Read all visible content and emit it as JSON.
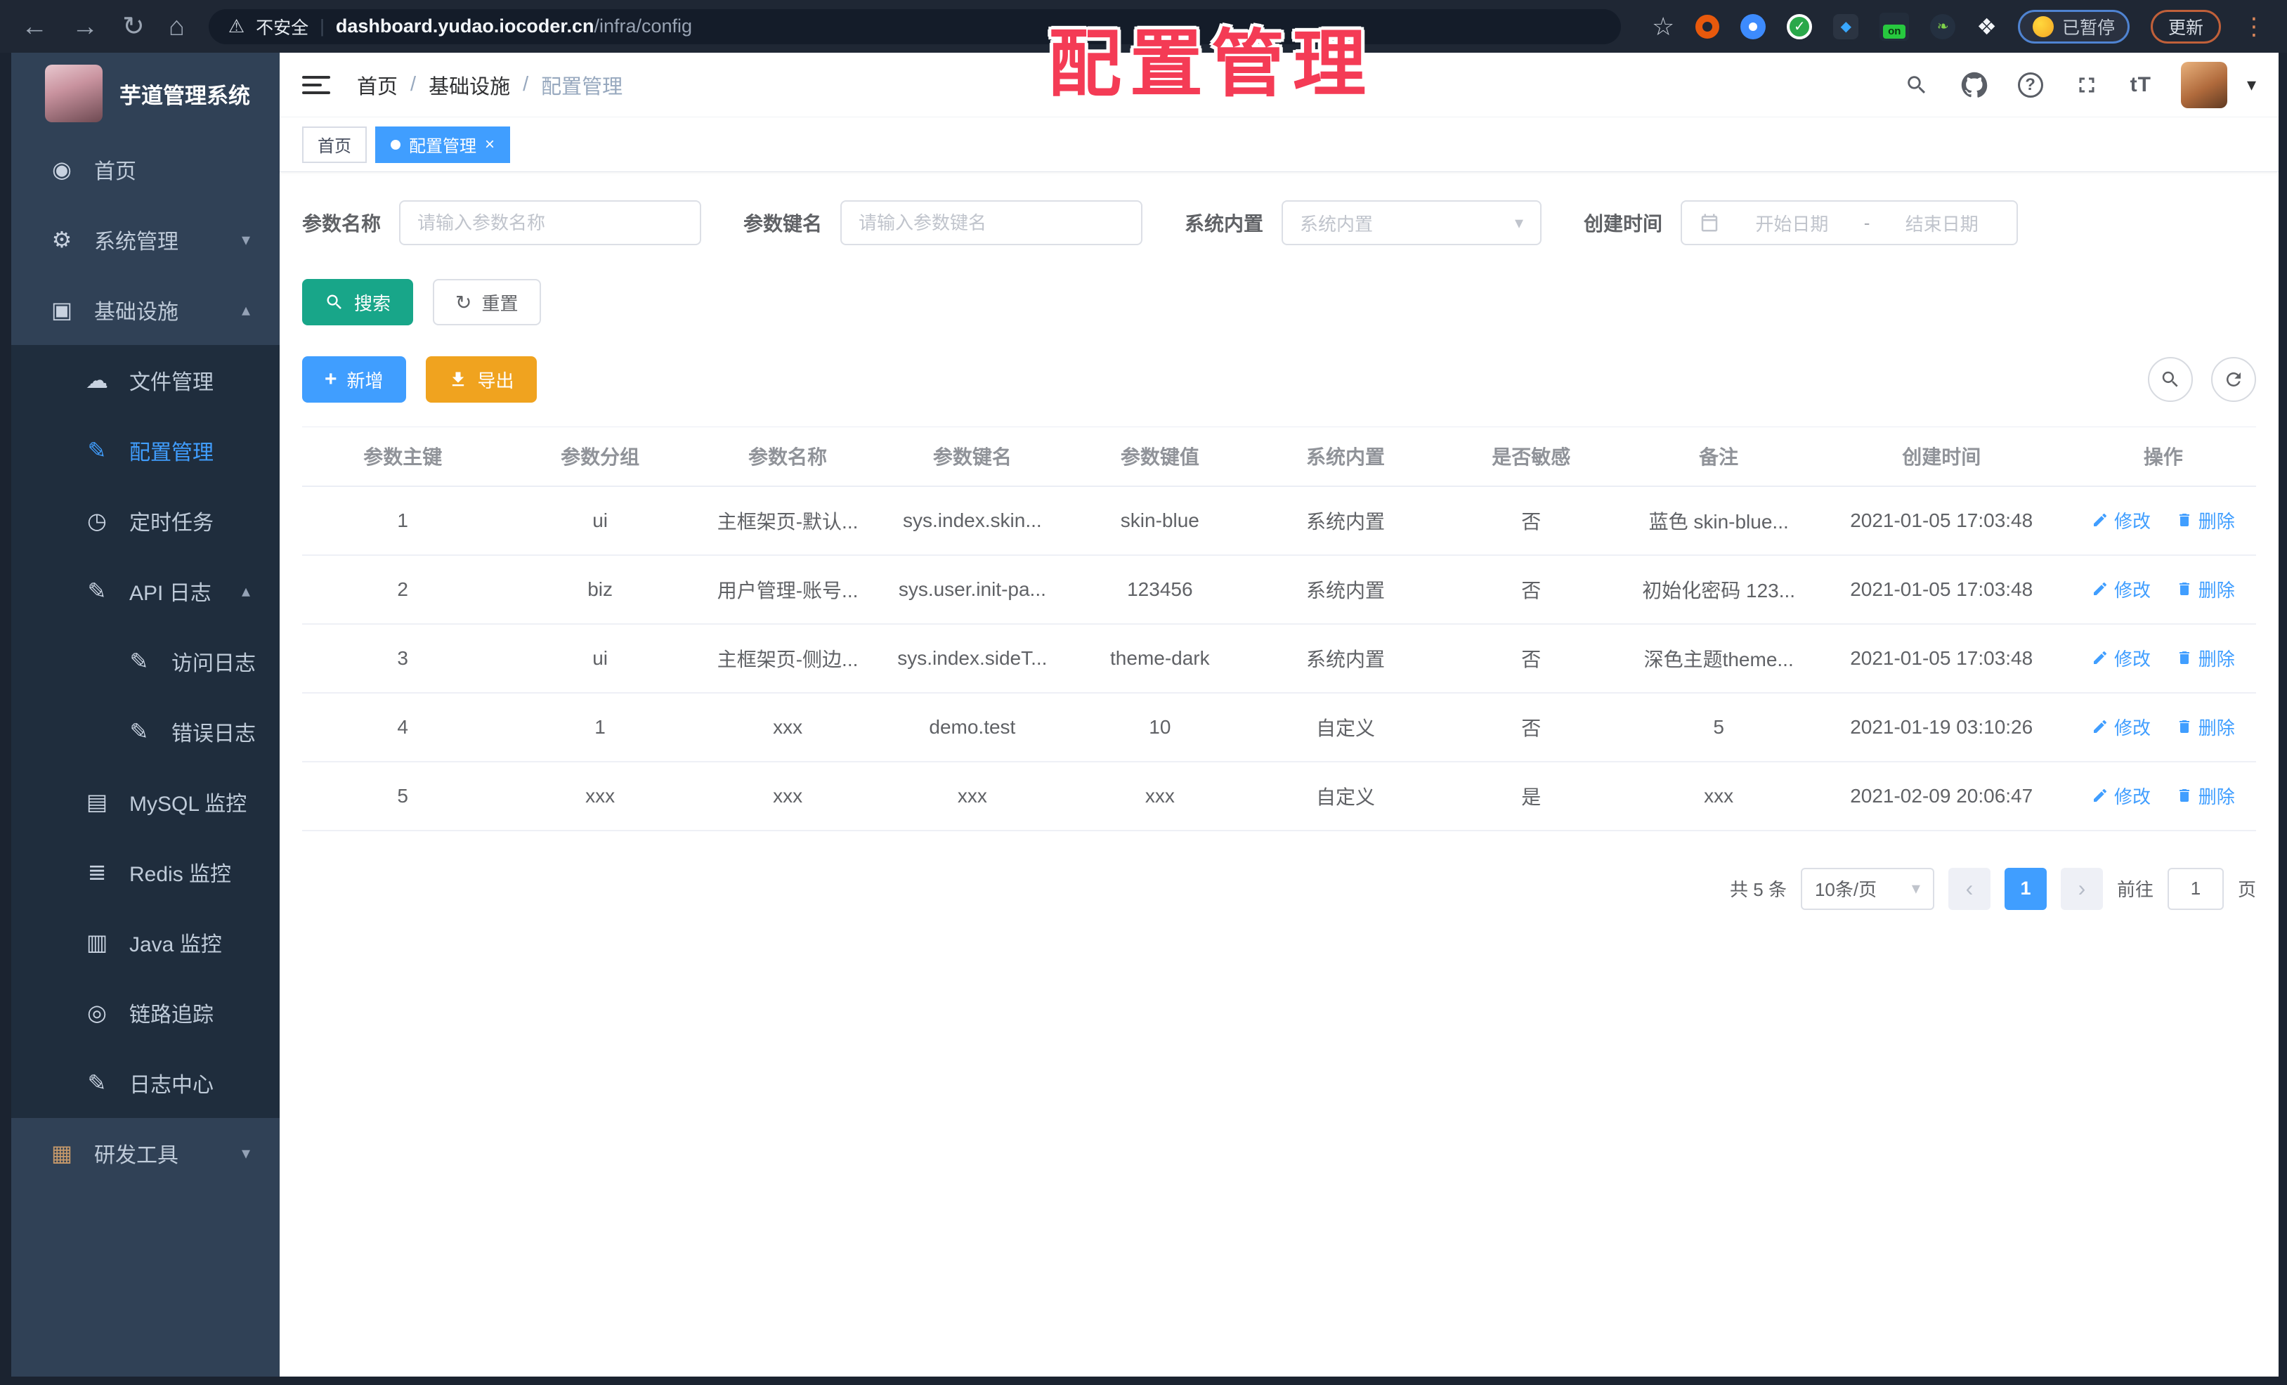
{
  "browser": {
    "insecure_label": "不安全",
    "url_host": "dashboard.yudao.iocoder.cn",
    "url_path": "/infra/config",
    "on_badge": "on",
    "paused_badge": "已暂停",
    "update_button": "更新"
  },
  "overlay_title": "配置管理",
  "sidebar": {
    "app_title": "芋道管理系统",
    "items": [
      {
        "name": "sidebar-item-home",
        "icon_name": "dashboard-icon",
        "glyph": "◉",
        "label": "首页",
        "chevron": "",
        "cls": "zone-light level-top"
      },
      {
        "name": "sidebar-item-system",
        "icon_name": "gear-icon",
        "glyph": "⚙",
        "label": "系统管理",
        "chevron": "▾",
        "cls": "zone-light level-top"
      },
      {
        "name": "sidebar-item-infra",
        "icon_name": "monitor-icon",
        "glyph": "▣",
        "label": "基础设施",
        "chevron": "▴",
        "cls": "zone-light level-top"
      },
      {
        "name": "sidebar-item-file",
        "icon_name": "cloud-upload-icon",
        "glyph": "☁",
        "label": "文件管理",
        "chevron": "",
        "cls": "zone-dark level-sub"
      },
      {
        "name": "sidebar-item-config",
        "icon_name": "edit-square-icon",
        "glyph": "✎",
        "label": "配置管理",
        "chevron": "",
        "cls": "zone-dark level-sub active"
      },
      {
        "name": "sidebar-item-job",
        "icon_name": "clock-icon",
        "glyph": "◷",
        "label": "定时任务",
        "chevron": "",
        "cls": "zone-dark level-sub"
      },
      {
        "name": "sidebar-item-api-log",
        "icon_name": "log-icon",
        "glyph": "✎",
        "label": "API 日志",
        "chevron": "▴",
        "cls": "zone-dark level-sub"
      },
      {
        "name": "sidebar-item-access-log",
        "icon_name": "log-icon",
        "glyph": "✎",
        "label": "访问日志",
        "chevron": "",
        "cls": "zone-dark level-subsub"
      },
      {
        "name": "sidebar-item-error-log",
        "icon_name": "log-icon",
        "glyph": "✎",
        "label": "错误日志",
        "chevron": "",
        "cls": "zone-dark level-subsub"
      },
      {
        "name": "sidebar-item-mysql",
        "icon_name": "database-icon",
        "glyph": "▤",
        "label": "MySQL 监控",
        "chevron": "",
        "cls": "zone-dark level-sub"
      },
      {
        "name": "sidebar-item-redis",
        "icon_name": "redis-icon",
        "glyph": "≣",
        "label": "Redis 监控",
        "chevron": "",
        "cls": "zone-dark level-sub"
      },
      {
        "name": "sidebar-item-java",
        "icon_name": "java-monitor-icon",
        "glyph": "▥",
        "label": "Java 监控",
        "chevron": "",
        "cls": "zone-dark level-sub"
      },
      {
        "name": "sidebar-item-trace",
        "icon_name": "eye-icon",
        "glyph": "◎",
        "label": "链路追踪",
        "chevron": "",
        "cls": "zone-dark level-sub"
      },
      {
        "name": "sidebar-item-log-center",
        "icon_name": "log-icon",
        "glyph": "✎",
        "label": "日志中心",
        "chevron": "",
        "cls": "zone-dark level-sub"
      },
      {
        "name": "sidebar-item-dev-tools",
        "icon_name": "toolbox-icon",
        "glyph": "▦",
        "label": "研发工具",
        "chevron": "▾",
        "cls": "zone-light level-top tool-tint"
      }
    ]
  },
  "breadcrumb": {
    "home": "首页",
    "section": "基础设施",
    "current": "配置管理",
    "separator": "/"
  },
  "tabs": {
    "first": "首页",
    "active": "配置管理"
  },
  "filters": {
    "name_label": "参数名称",
    "name_placeholder": "请输入参数名称",
    "key_label": "参数键名",
    "key_placeholder": "请输入参数键名",
    "type_label": "系统内置",
    "type_placeholder": "系统内置",
    "date_label": "创建时间",
    "date_start": "开始日期",
    "date_separator": "-",
    "date_end": "结束日期"
  },
  "actions": {
    "search": "搜索",
    "reset": "重置",
    "add": "新增",
    "export": "导出"
  },
  "table": {
    "headers": [
      "参数主键",
      "参数分组",
      "参数名称",
      "参数键名",
      "参数键值",
      "系统内置",
      "是否敏感",
      "备注",
      "创建时间",
      "操作"
    ],
    "edit_label": "修改",
    "delete_label": "删除",
    "rows": [
      {
        "cells": [
          "1",
          "ui",
          "主框架页-默认...",
          "sys.index.skin...",
          "skin-blue",
          "系统内置",
          "否",
          "蓝色 skin-blue...",
          "2021-01-05 17:03:48"
        ]
      },
      {
        "cells": [
          "2",
          "biz",
          "用户管理-账号...",
          "sys.user.init-pa...",
          "123456",
          "系统内置",
          "否",
          "初始化密码 123...",
          "2021-01-05 17:03:48"
        ]
      },
      {
        "cells": [
          "3",
          "ui",
          "主框架页-侧边...",
          "sys.index.sideT...",
          "theme-dark",
          "系统内置",
          "否",
          "深色主题theme...",
          "2021-01-05 17:03:48"
        ]
      },
      {
        "cells": [
          "4",
          "1",
          "xxx",
          "demo.test",
          "10",
          "自定义",
          "否",
          "5",
          "2021-01-19 03:10:26"
        ]
      },
      {
        "cells": [
          "5",
          "xxx",
          "xxx",
          "xxx",
          "xxx",
          "自定义",
          "是",
          "xxx",
          "2021-02-09 20:06:47"
        ]
      }
    ]
  },
  "pagination": {
    "total": "共 5 条",
    "page_size": "10条/页",
    "prev": "‹",
    "page": "1",
    "next": "›",
    "goto_label": "前往",
    "goto_value": "1",
    "page_unit": "页"
  },
  "colors": {
    "primary": "#409eff",
    "search_teal": "#18a689",
    "export_amber": "#f0a31f",
    "overlay_red": "#f43b55",
    "sidebar_bg": "#304156",
    "submenu_bg": "#1f2d3d"
  }
}
